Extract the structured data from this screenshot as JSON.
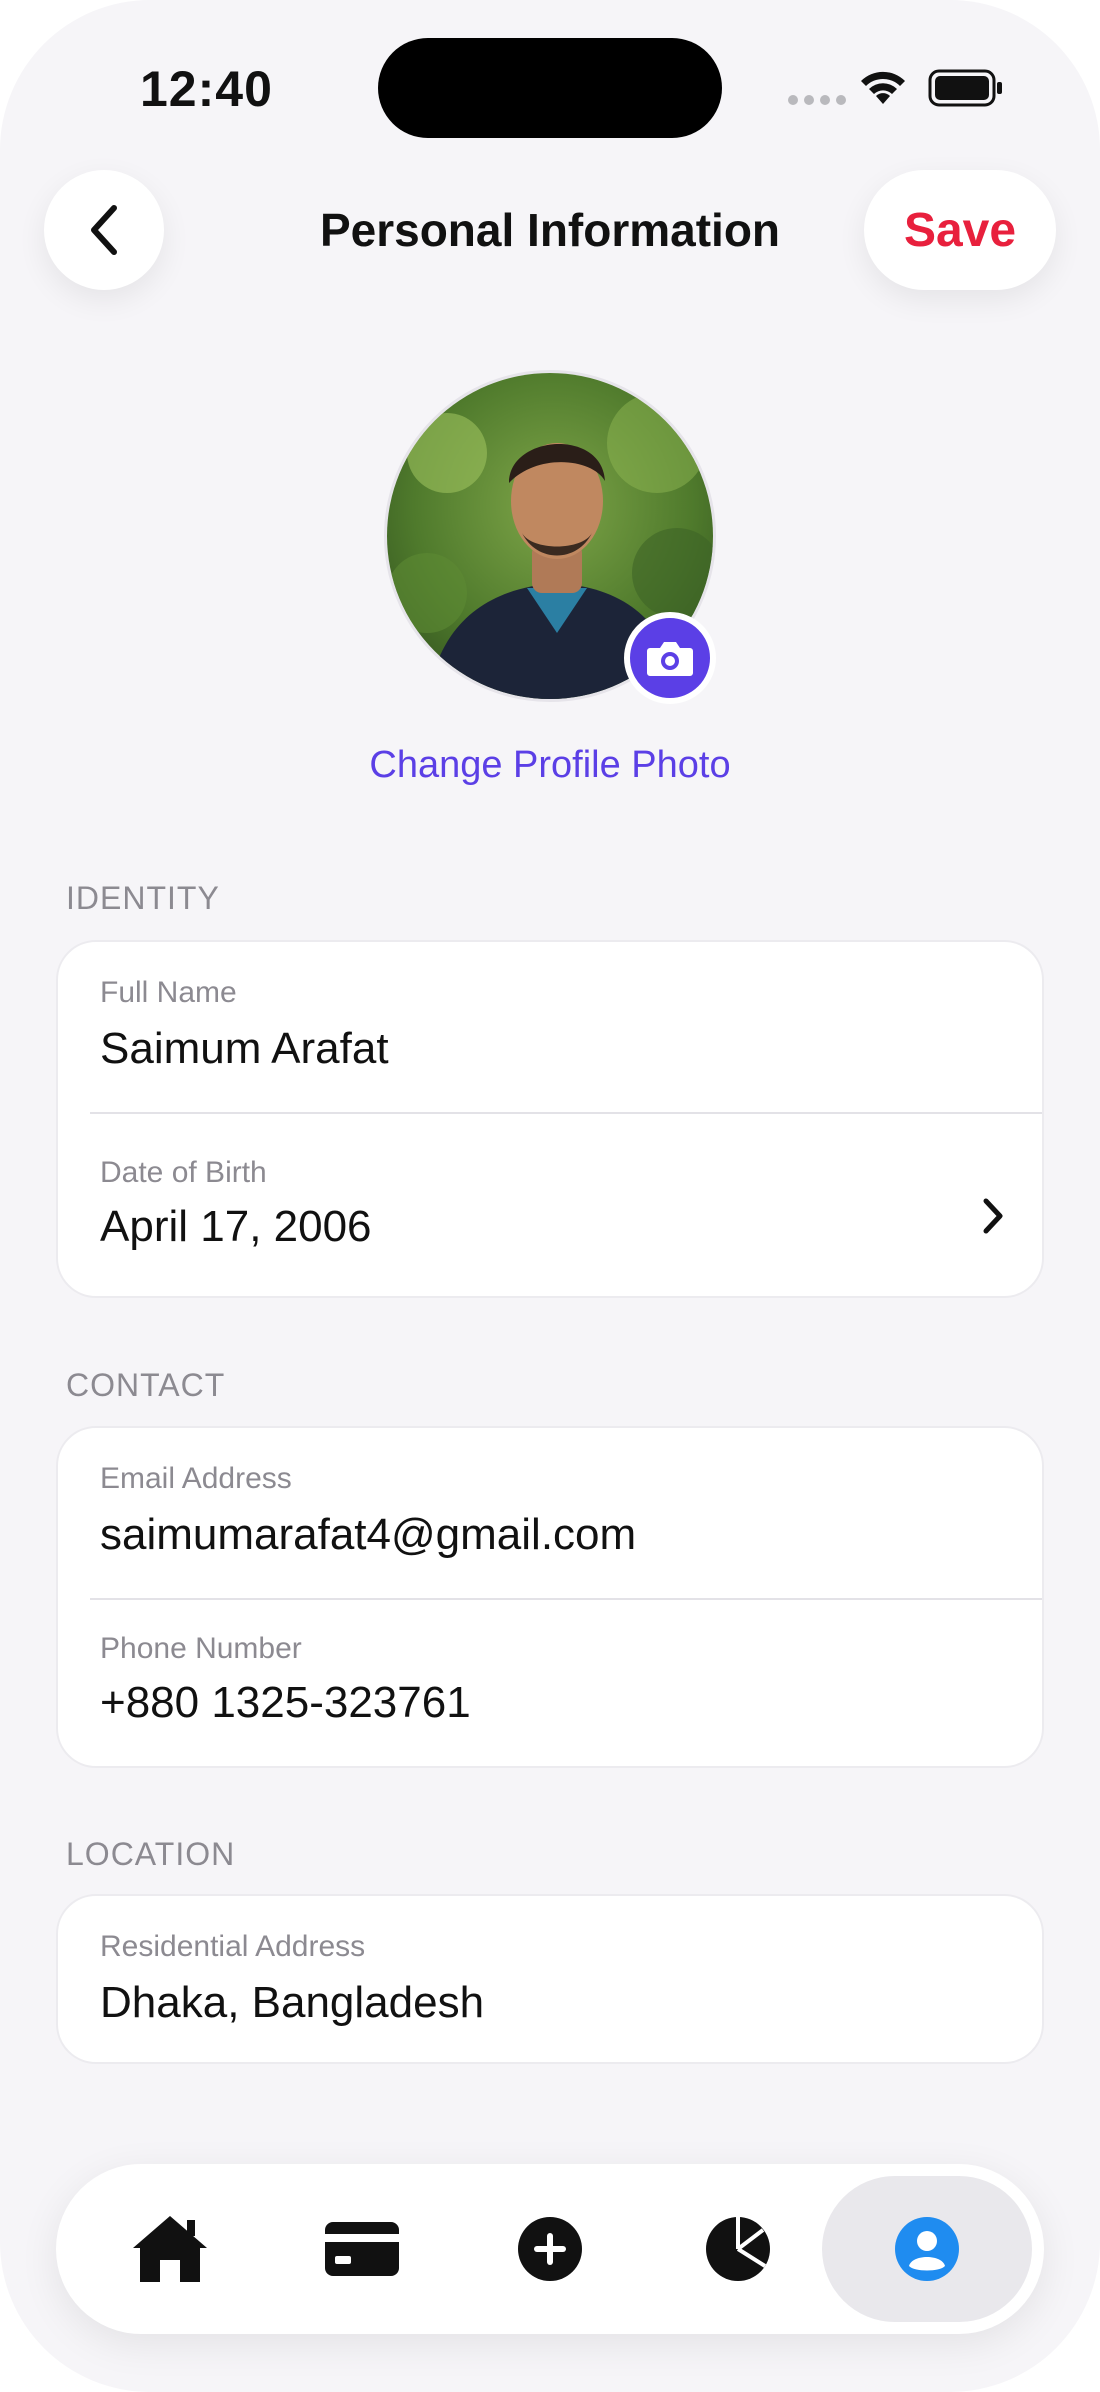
{
  "status_bar": {
    "time": "12:40"
  },
  "header": {
    "title": "Personal Information",
    "save_label": "Save"
  },
  "profile": {
    "change_photo_label": "Change Profile Photo"
  },
  "sections": {
    "identity": {
      "title": "IDENTITY",
      "full_name_label": "Full Name",
      "full_name_value": "Saimum Arafat",
      "dob_label": "Date of Birth",
      "dob_value": "April 17, 2006"
    },
    "contact": {
      "title": "CONTACT",
      "email_label": "Email Address",
      "email_value": "saimumarafat4@gmail.com",
      "phone_label": "Phone Number",
      "phone_value": "+880 1325-323761"
    },
    "location": {
      "title": "LOCATION",
      "address_label": "Residential Address",
      "address_value": "Dhaka, Bangladesh"
    }
  },
  "tabbar": {
    "items": [
      {
        "icon": "home-icon"
      },
      {
        "icon": "card-icon"
      },
      {
        "icon": "add-icon"
      },
      {
        "icon": "pie-chart-icon"
      },
      {
        "icon": "profile-icon",
        "active": true
      }
    ]
  },
  "colors": {
    "accent": "#5b3fe6",
    "save": "#e8203d",
    "profile_tab": "#1f8cf0",
    "background": "#f6f5f8"
  }
}
